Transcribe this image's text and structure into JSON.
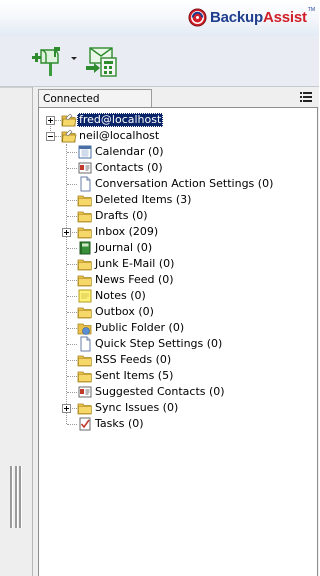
{
  "brand": {
    "part1": "Backup",
    "part2": "Assist",
    "tm": "TM"
  },
  "toolbar": {
    "connect_icon": "connect-mailbox-icon",
    "export_icon": "export-mailbox-icon"
  },
  "panel": {
    "tab_label": "Connected Mailboxes",
    "menu_icon": "list-menu-icon"
  },
  "tree": {
    "mailboxes": [
      {
        "label": "fred@localhost",
        "expanded": false,
        "selected": true
      },
      {
        "label": "neil@localhost",
        "expanded": true,
        "selected": false
      }
    ],
    "folders": [
      {
        "label": "Calendar (0)",
        "icon": "calendar-icon"
      },
      {
        "label": "Contacts (0)",
        "icon": "contacts-icon"
      },
      {
        "label": "Conversation Action Settings (0)",
        "icon": "document-icon"
      },
      {
        "label": "Deleted Items (3)",
        "icon": "folder-icon"
      },
      {
        "label": "Drafts (0)",
        "icon": "folder-icon"
      },
      {
        "label": "Inbox (209)",
        "icon": "folder-icon",
        "expandable": true
      },
      {
        "label": "Journal (0)",
        "icon": "journal-icon"
      },
      {
        "label": "Junk E-Mail (0)",
        "icon": "folder-icon"
      },
      {
        "label": "News Feed (0)",
        "icon": "folder-icon"
      },
      {
        "label": "Notes (0)",
        "icon": "notes-icon"
      },
      {
        "label": "Outbox (0)",
        "icon": "folder-icon"
      },
      {
        "label": "Public Folder (0)",
        "icon": "public-folder-icon"
      },
      {
        "label": "Quick Step Settings (0)",
        "icon": "document-icon"
      },
      {
        "label": "RSS Feeds (0)",
        "icon": "folder-icon"
      },
      {
        "label": "Sent Items (5)",
        "icon": "folder-icon"
      },
      {
        "label": "Suggested Contacts (0)",
        "icon": "contacts-icon"
      },
      {
        "label": "Sync Issues (0)",
        "icon": "folder-icon",
        "expandable": true
      },
      {
        "label": "Tasks (0)",
        "icon": "tasks-icon"
      }
    ]
  },
  "colors": {
    "selection": "#0a246a",
    "folder": "#f2cf5b",
    "brand_blue": "#1f3f8e",
    "brand_red": "#d01f28"
  }
}
